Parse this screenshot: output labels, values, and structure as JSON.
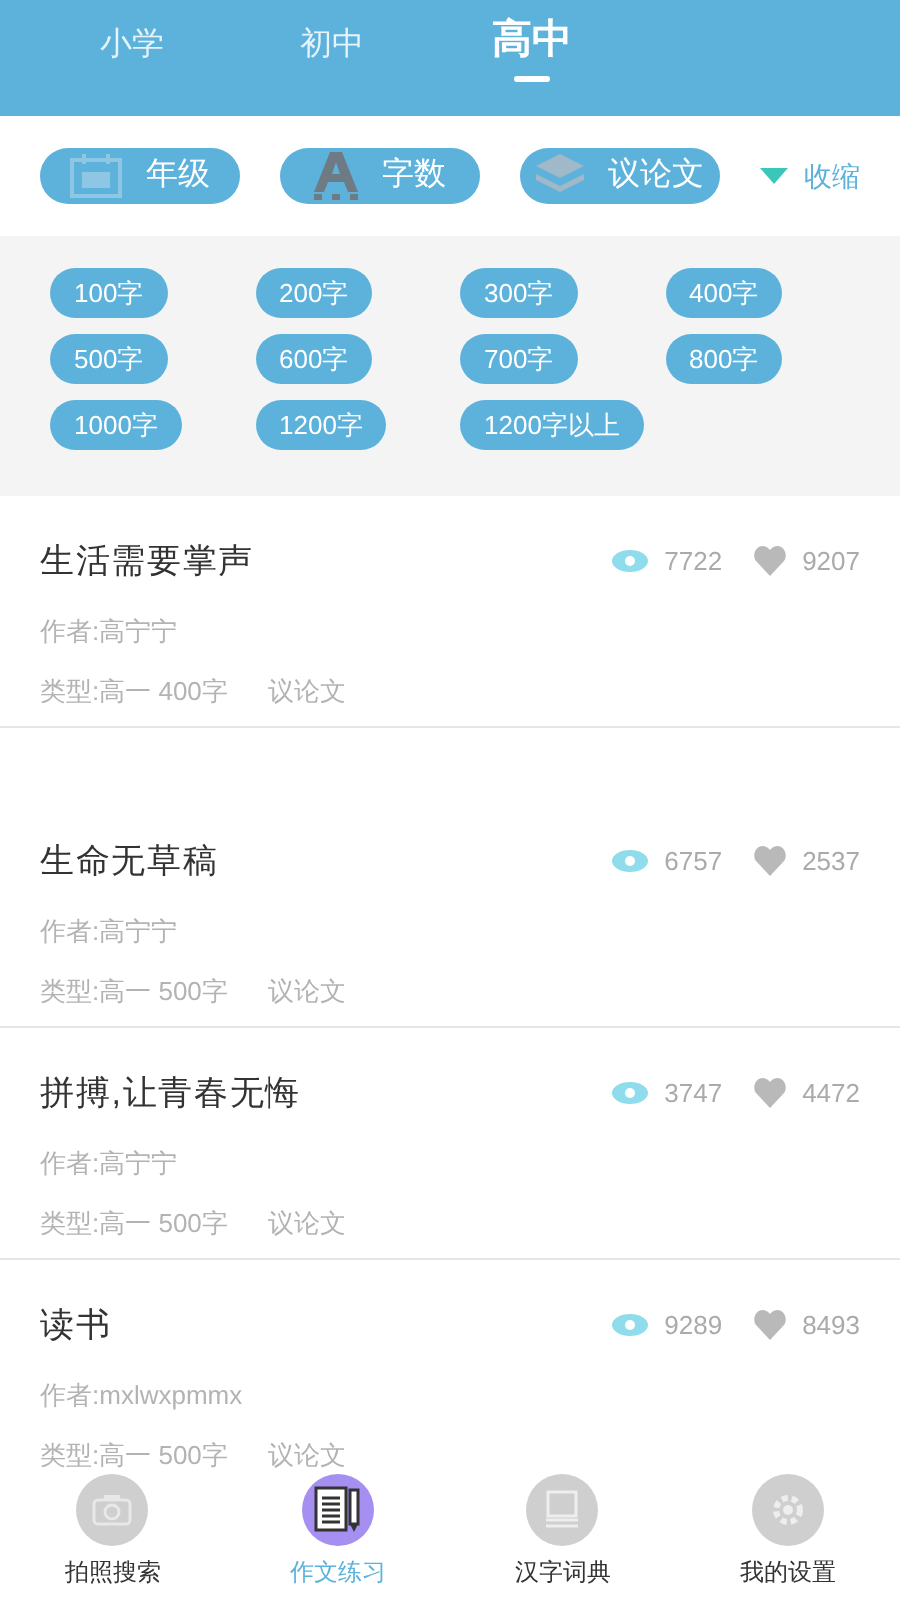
{
  "tabs": [
    {
      "label": "小学",
      "selected": false
    },
    {
      "label": "初中",
      "selected": false
    },
    {
      "label": "高中",
      "selected": true
    }
  ],
  "filters": [
    {
      "kind": "calendar",
      "label": "年级"
    },
    {
      "kind": "letter",
      "label": "字数"
    },
    {
      "kind": "layers",
      "label": "议论文"
    }
  ],
  "collapse": {
    "label": "收缩"
  },
  "word_counts": [
    "100字",
    "200字",
    "300字",
    "400字",
    "500字",
    "600字",
    "700字",
    "800字",
    "1000字",
    "1200字",
    "1200字以上"
  ],
  "essays": [
    {
      "title": "生活需要掌声",
      "views": "7722",
      "likes": "9207",
      "author": "作者:高宁宁",
      "type": "类型:高一 400字",
      "genre": "议论文"
    },
    {
      "title": "生命无草稿",
      "views": "6757",
      "likes": "2537",
      "author": "作者:高宁宁",
      "type": "类型:高一 500字",
      "genre": "议论文"
    },
    {
      "title": "拼搏,让青春无悔",
      "views": "3747",
      "likes": "4472",
      "author": "作者:高宁宁",
      "type": "类型:高一 500字",
      "genre": "议论文"
    },
    {
      "title": "读书",
      "views": "9289",
      "likes": "8493",
      "author": "作者:mxlwxpmmx",
      "type": "类型:高一 500字",
      "genre": "议论文"
    }
  ],
  "nav": [
    {
      "kind": "camera",
      "label": "拍照搜索",
      "selected": false
    },
    {
      "kind": "notebook",
      "label": "作文练习",
      "selected": true
    },
    {
      "kind": "book",
      "label": "汉字词典",
      "selected": false
    },
    {
      "kind": "gear",
      "label": "我的设置",
      "selected": false
    }
  ]
}
